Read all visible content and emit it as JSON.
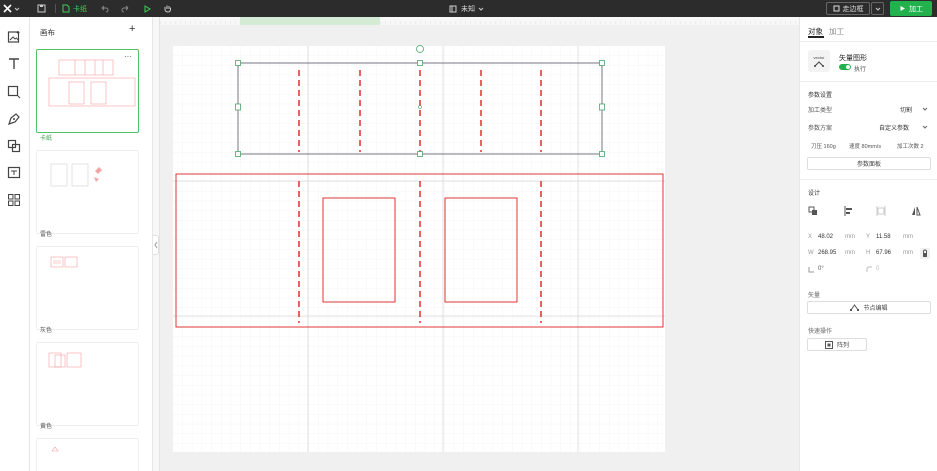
{
  "topbar": {
    "project_name": "卡纸",
    "doc_title": "未知",
    "frame_btn": "走边框",
    "process_btn": "加工"
  },
  "panel": {
    "title": "画布",
    "add": "+",
    "more": "···",
    "thumbs": [
      {
        "label": "卡纸"
      },
      {
        "label": "雷色"
      },
      {
        "label": "灰色"
      },
      {
        "label": "黄色"
      }
    ]
  },
  "right": {
    "tabs": [
      "对象",
      "加工"
    ],
    "object": {
      "title": "矢量图形",
      "toggle": "执行",
      "thumb_text": "vector"
    },
    "params_title": "参数设置",
    "mode_label": "加工类型",
    "mode_value": "切割",
    "scheme_label": "参数方案",
    "scheme_value": "自定义参数",
    "pressure": "刀压 160g",
    "speed": "速度 80mm/s",
    "times": "加工次数 2",
    "params_btn": "参数面板",
    "design_title": "设计",
    "x_label": "X",
    "x_val": "48.02",
    "x_unit": "mm",
    "y_label": "Y",
    "y_val": "11.58",
    "y_unit": "mm",
    "w_label": "W",
    "w_val": "268.95",
    "w_unit": "mm",
    "h_label": "H",
    "h_val": "67.96",
    "h_unit": "mm",
    "rot_val": "0°",
    "corner_val": "0",
    "vector_title": "矢量",
    "node_btn": "节点编辑",
    "quick_title": "快速操作",
    "array_btn": "阵列"
  },
  "colors": {
    "accent": "#22b14c",
    "cut_red": "#e02020",
    "dark": "#2c2c2c"
  }
}
